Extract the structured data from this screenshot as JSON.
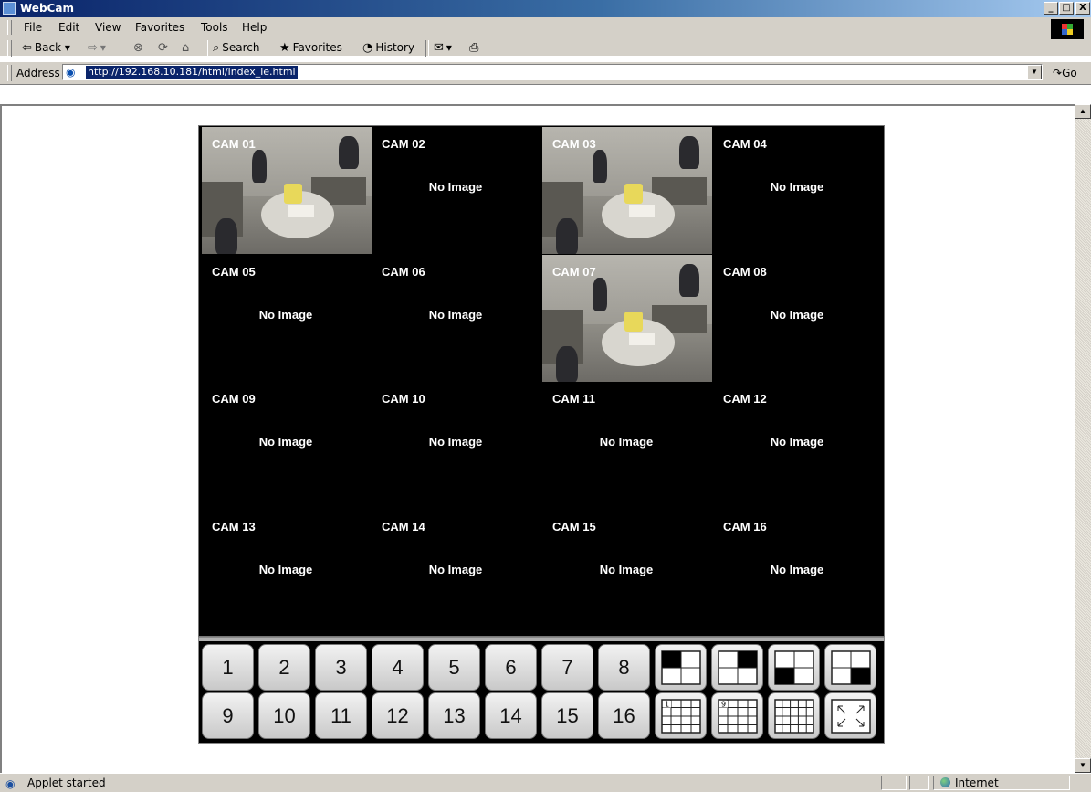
{
  "window": {
    "title": "WebCam",
    "controls": {
      "minimize": "_",
      "maximize": "□",
      "close": "X"
    }
  },
  "menu": {
    "items": [
      {
        "label": "File"
      },
      {
        "label": "Edit"
      },
      {
        "label": "View"
      },
      {
        "label": "Favorites"
      },
      {
        "label": "Tools"
      },
      {
        "label": "Help"
      }
    ]
  },
  "toolbar": {
    "back": "Back",
    "search": "Search",
    "favorites": "Favorites",
    "history": "History"
  },
  "address": {
    "label": "Address",
    "url": "http://192.168.10.181/html/index_ie.html",
    "go": "Go"
  },
  "cameras": [
    {
      "label": "CAM 01",
      "status": "",
      "has_feed": true
    },
    {
      "label": "CAM 02",
      "status": "No Image",
      "has_feed": false
    },
    {
      "label": "CAM 03",
      "status": "",
      "has_feed": true
    },
    {
      "label": "CAM 04",
      "status": "No Image",
      "has_feed": false
    },
    {
      "label": "CAM 05",
      "status": "No Image",
      "has_feed": false
    },
    {
      "label": "CAM 06",
      "status": "No Image",
      "has_feed": false
    },
    {
      "label": "CAM 07",
      "status": "",
      "has_feed": true
    },
    {
      "label": "CAM 08",
      "status": "No Image",
      "has_feed": false
    },
    {
      "label": "CAM 09",
      "status": "No Image",
      "has_feed": false
    },
    {
      "label": "CAM 10",
      "status": "No Image",
      "has_feed": false
    },
    {
      "label": "CAM 11",
      "status": "No Image",
      "has_feed": false
    },
    {
      "label": "CAM 12",
      "status": "No Image",
      "has_feed": false
    },
    {
      "label": "CAM 13",
      "status": "No Image",
      "has_feed": false
    },
    {
      "label": "CAM 14",
      "status": "No Image",
      "has_feed": false
    },
    {
      "label": "CAM 15",
      "status": "No Image",
      "has_feed": false
    },
    {
      "label": "CAM 16",
      "status": "No Image",
      "has_feed": false
    }
  ],
  "controls": {
    "channel_buttons": [
      "1",
      "2",
      "3",
      "4",
      "5",
      "6",
      "7",
      "8",
      "9",
      "10",
      "11",
      "12",
      "13",
      "14",
      "15",
      "16"
    ],
    "layout_buttons": [
      {
        "name": "quad-top-left-icon"
      },
      {
        "name": "quad-top-right-icon"
      },
      {
        "name": "quad-bottom-left-icon"
      },
      {
        "name": "quad-bottom-right-icon"
      },
      {
        "name": "grid-9-page-1-icon",
        "tag": "1"
      },
      {
        "name": "grid-9-page-9-icon",
        "tag": "9"
      },
      {
        "name": "grid-16-icon"
      },
      {
        "name": "fullscreen-icon"
      }
    ]
  },
  "status": {
    "text": "Applet started",
    "zone": "Internet"
  }
}
